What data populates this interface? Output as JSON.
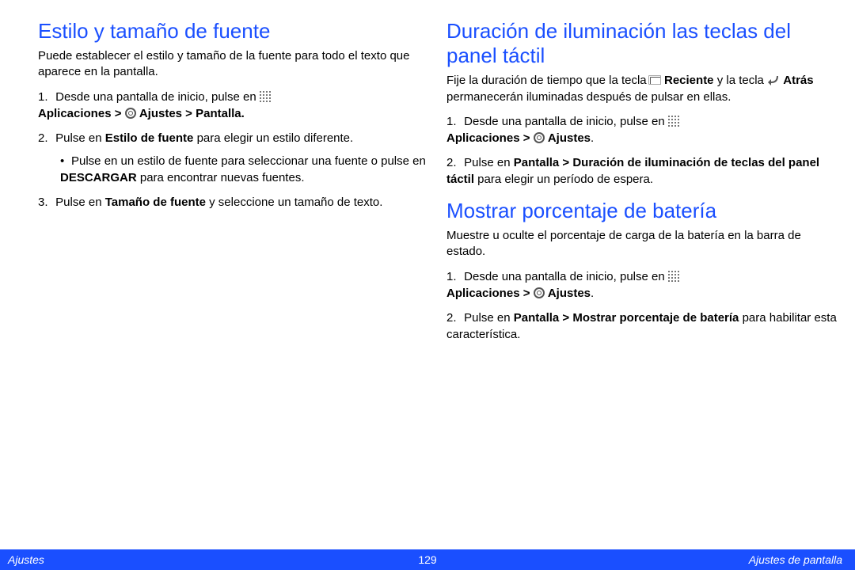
{
  "footer": {
    "left": "Ajustes",
    "page": "129",
    "right": "Ajustes de pantalla"
  },
  "left": {
    "title": "Estilo y tamaño de fuente",
    "lead": "Puede establecer el estilo y tamaño de la fuente para todo el texto que aparece en la pantalla.",
    "li1_a": "Desde una pantalla de inicio, pulse en ",
    "li1_b": "Aplicaciones > ",
    "li1_c": " Ajustes > Pantalla.",
    "li2_a": "Pulse en ",
    "li2_b": "Estilo de fuente",
    "li2_c": " para elegir un estilo diferente.",
    "li2_sub_a": "Pulse en un estilo de fuente para seleccionar una fuente o pulse en ",
    "li2_sub_b": "DESCARGAR",
    "li2_sub_c": " para encontrar nuevas fuentes.",
    "li3_a": "Pulse en ",
    "li3_b": "Tamaño de fuente",
    "li3_c": " y seleccione un tamaño de texto."
  },
  "rightA": {
    "title": "Duración de iluminación las teclas del panel táctil",
    "lead_a": "Fije la duración de tiempo que la tecla ",
    "lead_b": " Reciente",
    "lead_c": " y la tecla ",
    "lead_d": " Atrás",
    "lead_e": " permanecerán iluminadas después de pulsar en ellas.",
    "li1_a": "Desde una pantalla de inicio, pulse en ",
    "li1_b": "Aplicaciones > ",
    "li1_c": " Ajustes",
    "li2_a": "Pulse en ",
    "li2_b": "Pantalla > Duración de iluminación de teclas del panel táctil",
    "li2_c": " para elegir un período de espera."
  },
  "rightB": {
    "title": "Mostrar porcentaje de batería",
    "lead": "Muestre u oculte el porcentaje de carga de la batería en la barra de estado.",
    "li1_a": "Desde una pantalla de inicio, pulse en ",
    "li1_b": "Aplicaciones > ",
    "li1_c": " Ajustes",
    "li2_a": "Pulse en ",
    "li2_b": "Pantalla > Mostrar porcentaje de batería",
    "li2_c": " para habilitar esta característica."
  }
}
